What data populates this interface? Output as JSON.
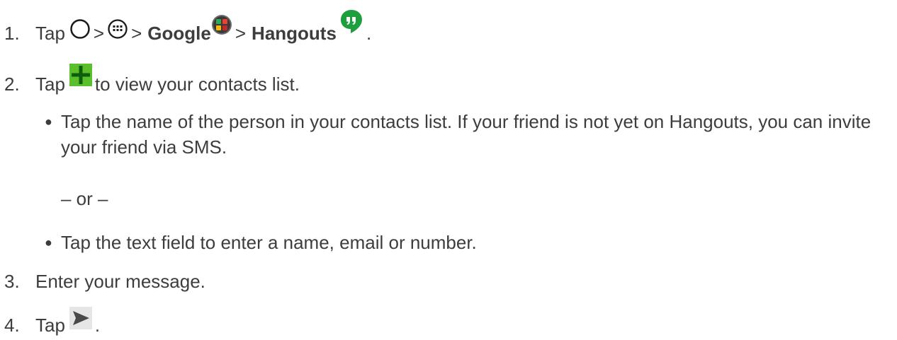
{
  "steps": [
    {
      "number": "1.",
      "parts": {
        "tap": "Tap",
        "sep1": ">",
        "sep2": ">",
        "google": "Google",
        "sep3": ">",
        "hangouts": "Hangouts",
        "end": "."
      },
      "icons": [
        "home-circle-icon",
        "apps-grid-icon",
        "google-folder-icon",
        "hangouts-icon"
      ]
    },
    {
      "number": "2.",
      "parts": {
        "tap": "Tap",
        "rest": "to view your contacts list."
      },
      "icons": [
        "add-plus-icon"
      ]
    },
    {
      "number": "3.",
      "parts": {
        "text": "Enter your message."
      }
    },
    {
      "number": "4.",
      "parts": {
        "tap": "Tap",
        "end": "."
      },
      "icons": [
        "send-arrow-icon"
      ]
    }
  ],
  "sub_items": [
    "Tap the name of the person in your contacts list. If your friend is not yet on Hangouts, you can invite your friend via SMS.",
    "Tap the text field to enter a name, email or number."
  ],
  "or_separator": "– or –",
  "colors": {
    "text": "#3d3d3d",
    "plus_bg": "#5bbf2b",
    "plus_fg": "#0d5d0d",
    "hangouts_green": "#1e9e3c",
    "send_bg": "#e6e6e6",
    "send_fg": "#4a4a4a"
  }
}
